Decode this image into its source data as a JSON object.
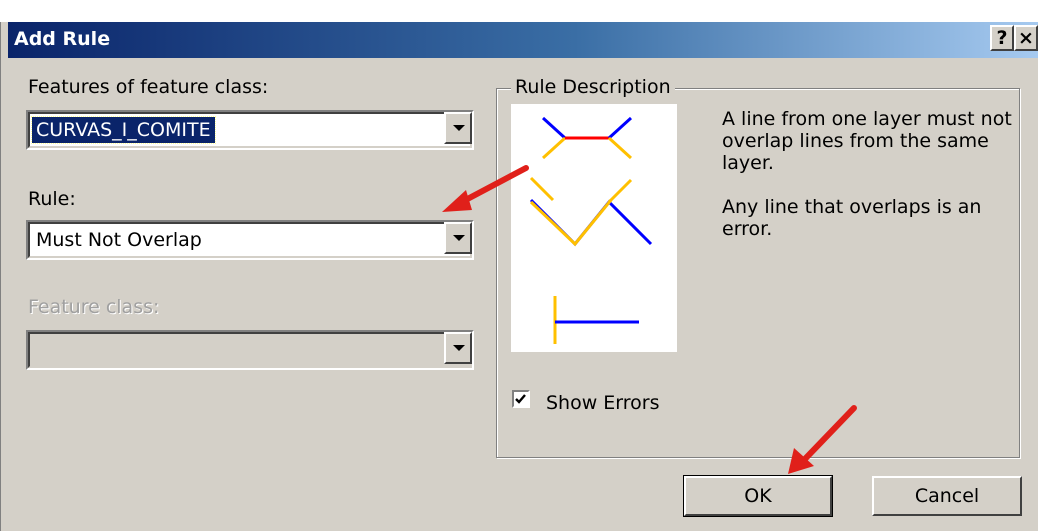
{
  "dialog": {
    "title": "Add Rule",
    "help_label": "?",
    "close_label": "×"
  },
  "features_label": "Features of feature class:",
  "features_value": "CURVAS_I_COMITE",
  "rule_label": "Rule:",
  "rule_value": "Must Not Overlap",
  "feature_class_label": "Feature class:",
  "feature_class_value": "",
  "rule_description": {
    "legend": "Rule Description",
    "paragraph1": "A line from one layer must not overlap lines from the same layer.",
    "paragraph2": "Any line that overlaps is an error."
  },
  "show_errors": {
    "label": "Show Errors",
    "checked": true
  },
  "buttons": {
    "ok": "OK",
    "cancel": "Cancel"
  },
  "colors": {
    "error_red": "#ff0000",
    "line_blue": "#0000ff",
    "line_yellow": "#ffc000",
    "titlebar_start": "#0a246a",
    "titlebar_end": "#a6caf0",
    "annotation_arrow": "#e0201a"
  },
  "icons": {
    "dropdown": "chevron-down-icon",
    "check": "checkmark-icon",
    "annotation": "red-arrow-icon"
  }
}
